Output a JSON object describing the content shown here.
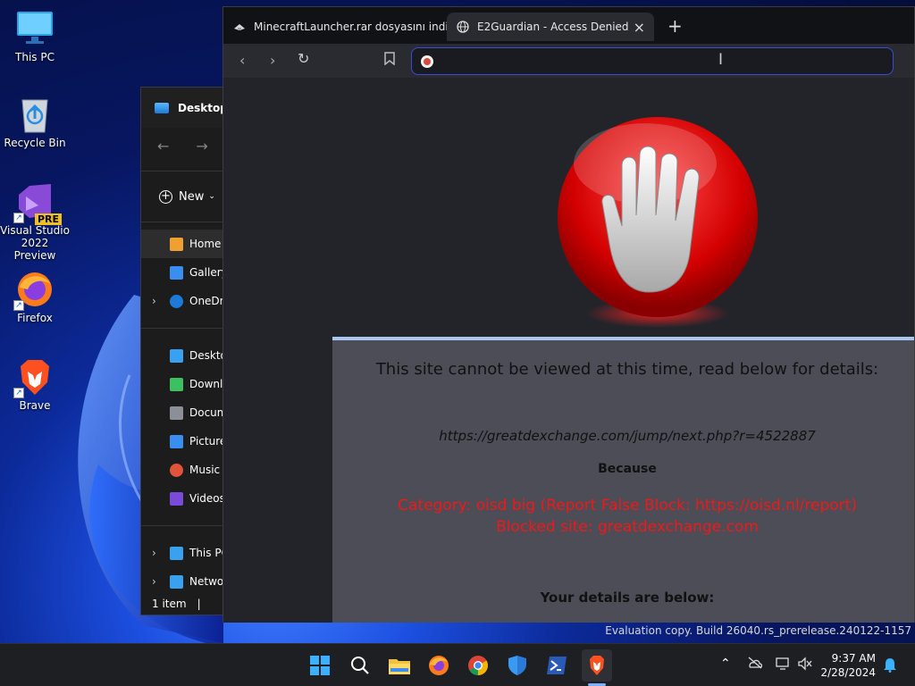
{
  "desktop": {
    "icons": [
      {
        "label": "This PC"
      },
      {
        "label": "Recycle Bin"
      },
      {
        "label": "Visual Studio 2022 Preview",
        "badge": "PRE"
      },
      {
        "label": "Firefox"
      },
      {
        "label": "Brave"
      }
    ]
  },
  "explorer": {
    "title": "Desktop",
    "new_label": "New",
    "nav_items": [
      {
        "label": "Home",
        "icon": "home-icon",
        "color": "#f0a030"
      },
      {
        "label": "Gallery",
        "icon": "gallery-icon",
        "color": "#3a8ef0"
      },
      {
        "label": "OneDrive",
        "icon": "cloud-icon",
        "color": "#1e7ad8"
      },
      {
        "label": "Desktop",
        "icon": "desktop-icon",
        "color": "#3aa0f0"
      },
      {
        "label": "Downloads",
        "icon": "download-icon",
        "color": "#3cc060"
      },
      {
        "label": "Documents",
        "icon": "document-icon",
        "color": "#8a8f98"
      },
      {
        "label": "Pictures",
        "icon": "picture-icon",
        "color": "#3a8ef0"
      },
      {
        "label": "Music",
        "icon": "music-icon",
        "color": "#e0543c"
      },
      {
        "label": "Videos",
        "icon": "video-icon",
        "color": "#7a4bd8"
      },
      {
        "label": "This PC",
        "icon": "computer-icon",
        "color": "#3aa0f0"
      },
      {
        "label": "Network",
        "icon": "network-icon",
        "color": "#3aa0f0"
      }
    ],
    "status": "1 item"
  },
  "browser": {
    "tabs": [
      {
        "label": "MinecraftLauncher.rar dosyasını indir",
        "icon": "download-site-icon"
      },
      {
        "label": "E2Guardian - Access Denied",
        "icon": "globe-icon"
      }
    ],
    "address_value": "",
    "page": {
      "title": "This site cannot be viewed at this time, read below for details:",
      "url": "https://greatdexchange.com/jump/next.php?r=4522887",
      "because": "Because",
      "category": "Category: oisd big (Report False Block: https://oisd.nl/report)",
      "blocked": "Blocked site: greatdexchange.com",
      "details": "Your details are below:"
    }
  },
  "watermark": "Evaluation copy. Build 26040.rs_prerelease.240122-1157",
  "taskbar": {
    "time": "9:37 AM",
    "date": "2/28/2024",
    "apps": [
      "start-icon",
      "search-icon",
      "file-explorer-icon",
      "firefox-icon",
      "chrome-icon",
      "defender-icon",
      "powershell-icon",
      "brave-icon"
    ]
  }
}
